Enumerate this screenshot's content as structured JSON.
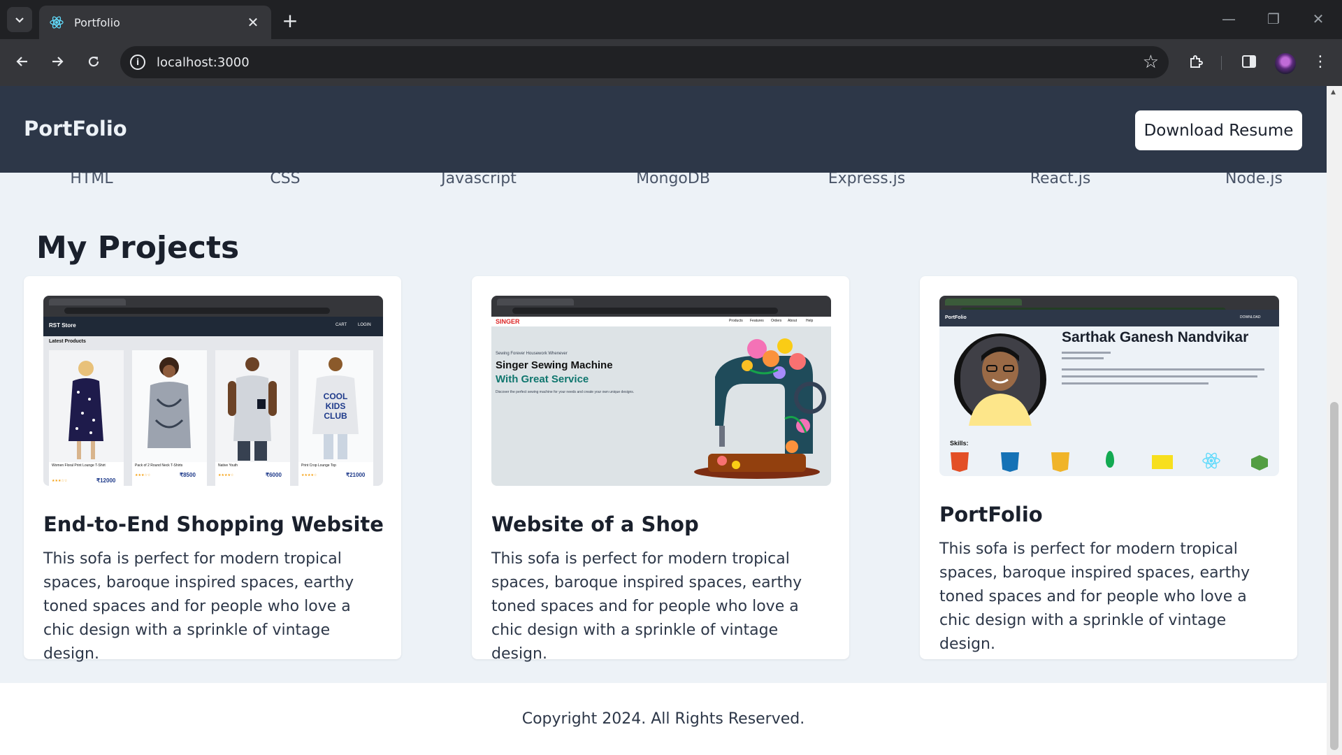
{
  "browser": {
    "tab_title": "Portfolio",
    "url": "localhost:3000",
    "icons": {
      "tab_dropdown": "chevron-down-icon",
      "tab_favicon": "react-icon",
      "tab_close": "close-icon",
      "new_tab": "plus-icon",
      "back": "arrow-left-icon",
      "forward": "arrow-right-icon",
      "reload": "reload-icon",
      "site_info": "info-icon",
      "bookmark": "star-icon",
      "extensions": "puzzle-icon",
      "side_panel": "side-panel-icon",
      "menu": "kebab-menu-icon"
    }
  },
  "header": {
    "logo": "PortFolio",
    "resume_button": "Download Resume"
  },
  "skills": [
    "HTML",
    "CSS",
    "Javascript",
    "MongoDB",
    "Express.js",
    "React.js",
    "Node.js"
  ],
  "projects_section": {
    "title": "My Projects",
    "projects": [
      {
        "title": "End-to-End Shopping Website",
        "description": "This sofa is perfect for modern tropical spaces, baroque inspired spaces, earthy toned spaces and for people who love a chic design with a sprinkle of vintage design.",
        "shot": {
          "store_name": "RST Store",
          "cart": "CART",
          "login": "LOGIN",
          "heading": "Latest Products",
          "items": [
            {
              "name": "Women Floral Print Lounge T-Shirt",
              "price": "₹12000"
            },
            {
              "name": "Pack of 2 Round Neck T-Shirts",
              "price": "₹8500"
            },
            {
              "name": "Native Youth",
              "price": "₹6000"
            },
            {
              "name": "Print Crop Lounge Top",
              "price": "₹21000"
            }
          ]
        }
      },
      {
        "title": "Website of a Shop",
        "description": "This sofa is perfect for modern tropical spaces, baroque inspired spaces, earthy toned spaces and for people who love a chic design with a sprinkle of vintage design.",
        "shot": {
          "brand": "SINGER",
          "nav": [
            "Products",
            "Features",
            "Orders",
            "About",
            "Help"
          ],
          "kicker": "Sewing Forever Housework Whenever",
          "headline": "Singer Sewing Machine",
          "subheadline": "With Great Service",
          "blurb": "Discover the perfect sewing machine for your needs and create your own unique designs."
        }
      },
      {
        "title": "PortFolio",
        "description": "This sofa is perfect for modern tropical spaces, baroque inspired spaces, earthy toned spaces and for people who love a chic design with a sprinkle of vintage design.",
        "shot": {
          "logo": "PortFolio",
          "download": "DOWNLOAD",
          "name": "Sarthak Ganesh Nandvikar",
          "skills_label": "Skills:"
        }
      }
    ]
  },
  "footer": {
    "copyright": "Copyright 2024. All Rights Reserved."
  },
  "colors": {
    "header_bg": "#2d3748",
    "page_bg": "#edf2f7",
    "text_dark": "#1a202c"
  }
}
